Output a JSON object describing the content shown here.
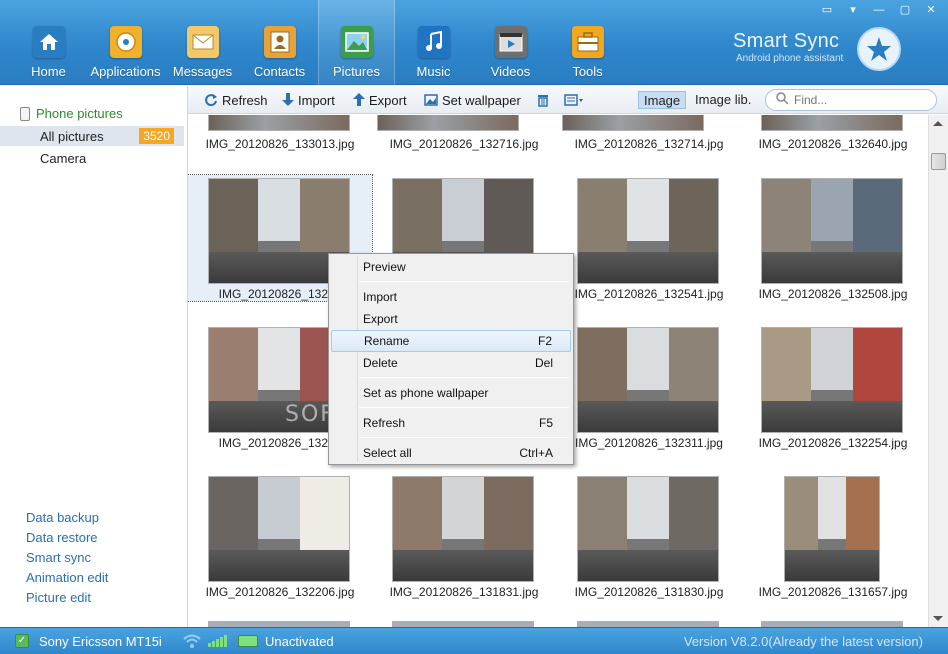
{
  "window": {
    "controls": [
      "▭",
      "▾",
      "—",
      "▢",
      "✕"
    ]
  },
  "nav": [
    {
      "label": "Home",
      "icon": "home-icon",
      "color": "#2a7dc0"
    },
    {
      "label": "Applications",
      "icon": "applications-icon",
      "color": "#f0b22a"
    },
    {
      "label": "Messages",
      "icon": "messages-icon",
      "color": "#f3c86a"
    },
    {
      "label": "Contacts",
      "icon": "contacts-icon",
      "color": "#e7a23a"
    },
    {
      "label": "Pictures",
      "icon": "pictures-icon",
      "color": "#3e9d4a"
    },
    {
      "label": "Music",
      "icon": "music-icon",
      "color": "#1f74c4"
    },
    {
      "label": "Videos",
      "icon": "videos-icon",
      "color": "#6f6f6f"
    },
    {
      "label": "Tools",
      "icon": "tools-icon",
      "color": "#f2a81e"
    }
  ],
  "nav_active": 4,
  "brand": {
    "title": "Smart Sync",
    "subtitle": "Android phone assistant"
  },
  "sidebar": {
    "root": "Phone pictures",
    "items": [
      {
        "label": "All pictures",
        "count": "3520"
      },
      {
        "label": "Camera"
      }
    ],
    "links": [
      "Data backup",
      "Data restore",
      "Smart sync",
      "Animation edit",
      "Picture edit"
    ]
  },
  "toolbar": {
    "refresh": "Refresh",
    "import": "Import",
    "export": "Export",
    "wallpaper": "Set wallpaper",
    "view_image": "Image",
    "view_lib": "Image lib.",
    "search_placeholder": "Find..."
  },
  "top_row": [
    "IMG_20120826_133013.jpg",
    "IMG_20120826_132716.jpg",
    "IMG_20120826_132714.jpg",
    "IMG_20120826_132640.jpg"
  ],
  "photos": [
    {
      "name": "IMG_20120826_13255",
      "orient": "landscape"
    },
    {
      "name": "",
      "orient": "landscape"
    },
    {
      "name": "IMG_20120826_132541.jpg",
      "orient": "landscape"
    },
    {
      "name": "IMG_20120826_132508.jpg",
      "orient": "landscape"
    },
    {
      "name": "IMG_20120826_13245",
      "orient": "landscape"
    },
    {
      "name": "",
      "orient": "landscape"
    },
    {
      "name": "IMG_20120826_132311.jpg",
      "orient": "landscape"
    },
    {
      "name": "IMG_20120826_132254.jpg",
      "orient": "landscape"
    },
    {
      "name": "IMG_20120826_132206.jpg",
      "orient": "landscape"
    },
    {
      "name": "IMG_20120826_131831.jpg",
      "orient": "landscape"
    },
    {
      "name": "IMG_20120826_131830.jpg",
      "orient": "landscape"
    },
    {
      "name": "IMG_20120826_131657.jpg",
      "orient": "portrait"
    }
  ],
  "context_menu": [
    {
      "label": "Preview",
      "shortcut": ""
    },
    {
      "sep": true
    },
    {
      "label": "Import",
      "shortcut": ""
    },
    {
      "label": "Export",
      "shortcut": ""
    },
    {
      "label": "Rename",
      "shortcut": "F2",
      "hover": true
    },
    {
      "label": "Delete",
      "shortcut": "Del"
    },
    {
      "sep": true
    },
    {
      "label": "Set as phone wallpaper",
      "shortcut": ""
    },
    {
      "sep": true
    },
    {
      "label": "Refresh",
      "shortcut": "F5"
    },
    {
      "sep": true
    },
    {
      "label": "Select all",
      "shortcut": "Ctrl+A"
    }
  ],
  "status": {
    "device": "Sony Ericsson MT15i",
    "activation": "Unactivated",
    "version": "Version V8.2.0(Already the latest version)"
  },
  "watermark": "SOFTPEDIA"
}
